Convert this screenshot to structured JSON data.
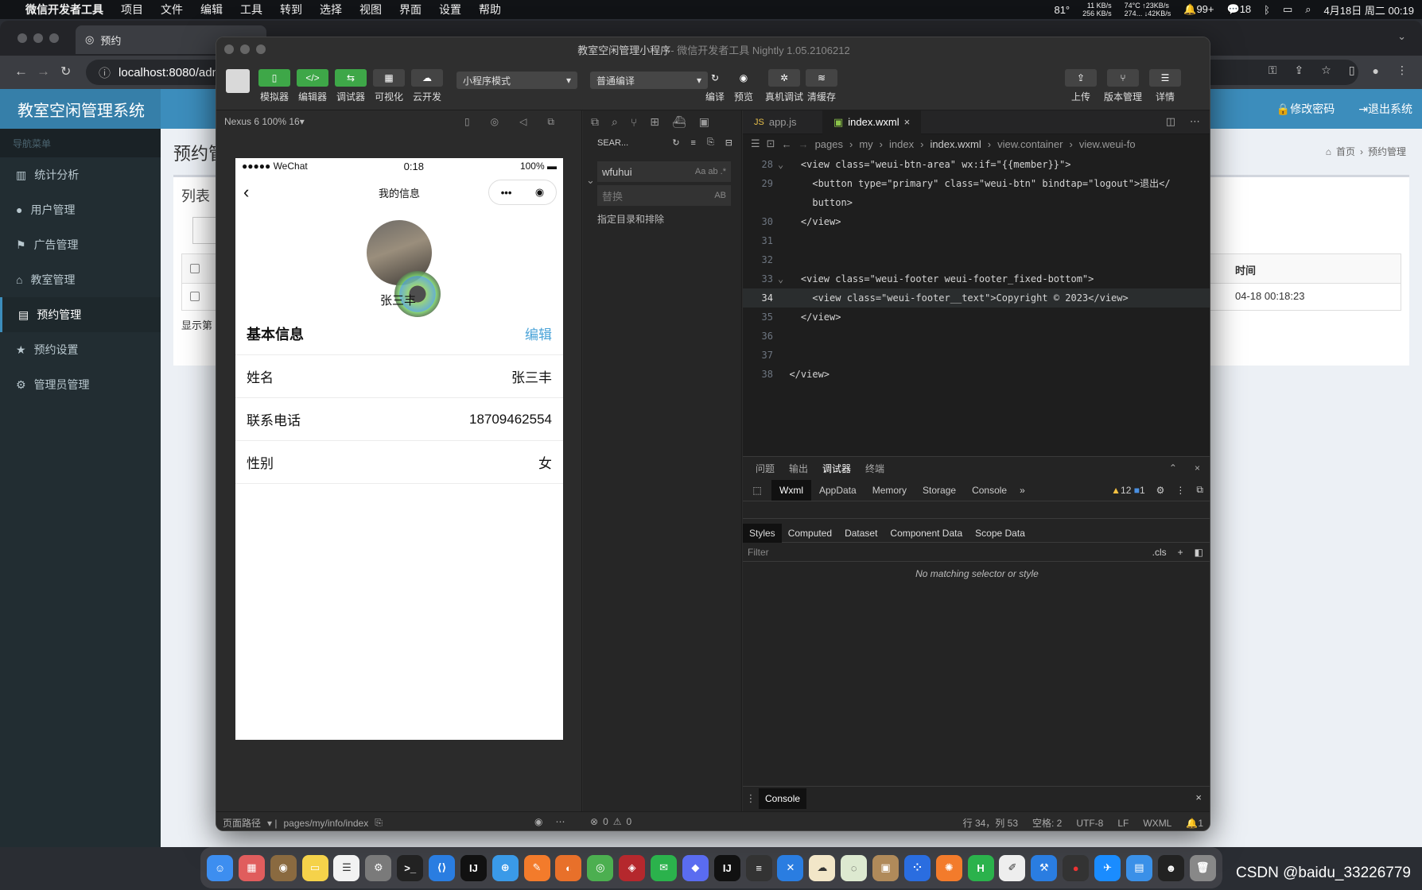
{
  "menubar": {
    "app": "微信开发者工具",
    "items": [
      "项目",
      "文件",
      "编辑",
      "工具",
      "转到",
      "选择",
      "视图",
      "界面",
      "设置",
      "帮助"
    ],
    "temp": "81°",
    "net_up": "11 KB/s",
    "net_down": "256 KB/s",
    "cpu_temp": "74°C",
    "cpu_stat": "274...",
    "rate_up": "↑23KB/s",
    "rate_down": "↓42KB/s",
    "bell_count": "99+",
    "wechat_count": "18",
    "datetime": "4月18日 周二 00:19"
  },
  "browser": {
    "tab_title": "预约",
    "url": "localhost:8080/adn"
  },
  "site": {
    "logo": "教室空闲管理系统",
    "nav_header": "导航菜单",
    "nav": [
      "统计分析",
      "用户管理",
      "广告管理",
      "教室管理",
      "预约管理",
      "预约设置",
      "管理员管理"
    ],
    "change_pwd": "修改密码",
    "logout": "退出系统",
    "page_title": "预约管",
    "panel_title": "列表",
    "crumb_home": "首页",
    "crumb_current": "预约管理",
    "col_time": "时间",
    "cell_time": "04-18 00:18:23",
    "show_text": "显示第"
  },
  "dev": {
    "title": "教室空闲管理小程序",
    "title_suffix": " - 微信开发者工具 Nightly 1.05.2106212",
    "toolbar": {
      "simulator": "模拟器",
      "editor": "编辑器",
      "debugger": "调试器",
      "visual": "可视化",
      "cloud": "云开发",
      "mode": "小程序模式",
      "compile_mode": "普通编译",
      "compile": "编译",
      "preview": "预览",
      "real_debug": "真机调试",
      "clear_cache": "清缓存",
      "upload": "上传",
      "version": "版本管理",
      "details": "详情"
    },
    "device": "Nexus 6 100% 16",
    "phone": {
      "carrier": "●●●●● WeChat",
      "time": "0:18",
      "battery": "100%",
      "nav_title": "我的信息",
      "name_caption": "张三丰",
      "section_title": "基本信息",
      "edit": "编辑",
      "rows": [
        {
          "label": "姓名",
          "value": "张三丰"
        },
        {
          "label": "联系电话",
          "value": "18709462554"
        },
        {
          "label": "性别",
          "value": "女"
        }
      ]
    },
    "search": {
      "header": "SEAR...",
      "query": "wfuhui",
      "replace_placeholder": "替换",
      "include_toggle": "指定目录和排除"
    },
    "editor": {
      "tabs": [
        "app.js",
        "index.wxml"
      ],
      "crumbs": [
        "pages",
        "my",
        "index",
        "index.wxml",
        "view.container",
        "view.weui-fo"
      ],
      "lines": [
        {
          "n": "28",
          "code": "<view class=\"weui-btn-area\" wx:if=\"{{member}}\">"
        },
        {
          "n": "29",
          "code": "<button type=\"primary\" class=\"weui-btn\" bindtap=\"logout\">退出</"
        },
        {
          "n": "",
          "code": "button>"
        },
        {
          "n": "30",
          "code": "</view>"
        },
        {
          "n": "31",
          "code": ""
        },
        {
          "n": "32",
          "code": ""
        },
        {
          "n": "33",
          "code": "<view class=\"weui-footer weui-footer_fixed-bottom\">"
        },
        {
          "n": "34",
          "code": "<view class=\"weui-footer__text\">Copyright © 2023</view>"
        },
        {
          "n": "35",
          "code": "</view>"
        },
        {
          "n": "36",
          "code": ""
        },
        {
          "n": "37",
          "code": ""
        },
        {
          "n": "38",
          "code": "</view>"
        }
      ]
    },
    "debug": {
      "panel_tabs": [
        "问题",
        "输出",
        "调试器",
        "终端"
      ],
      "tool_tabs": [
        "Wxml",
        "AppData",
        "Memory",
        "Storage",
        "Console"
      ],
      "warn_count": "12",
      "info_count": "1",
      "style_tabs": [
        "Styles",
        "Computed",
        "Dataset",
        "Component Data",
        "Scope Data"
      ],
      "filter_placeholder": "Filter",
      "cls": ".cls",
      "empty": "No matching selector or style",
      "console_tab": "Console"
    },
    "status": {
      "page_path_label": "页面路径",
      "page_path": "pages/my/info/index",
      "errors": "0",
      "warnings": "0",
      "position": "行 34，列 53",
      "spaces": "空格: 2",
      "encoding": "UTF-8",
      "eol": "LF",
      "lang": "WXML",
      "notif": "1"
    }
  },
  "watermark": "CSDN @baidu_33226779",
  "colors": {
    "admin_blue": "#3c8dbc",
    "sidebar": "#222d32",
    "wx_green": "#3ea748",
    "link": "#4aa3d8"
  }
}
